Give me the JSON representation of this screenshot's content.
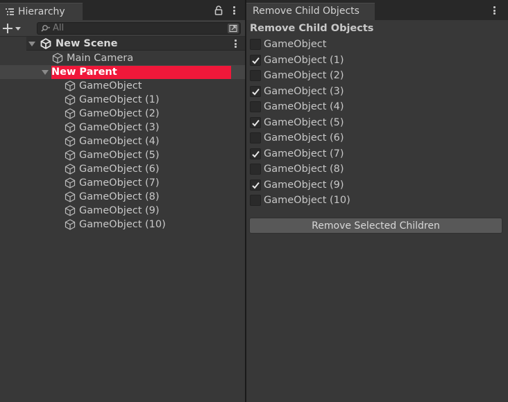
{
  "hierarchy": {
    "tab_label": "Hierarchy",
    "search_placeholder": "All",
    "scene_name": "New Scene",
    "items": [
      {
        "label": "Main Camera",
        "icon": "camera-object-icon"
      },
      {
        "label": "New Parent",
        "icon": "none",
        "selected": true
      },
      {
        "label": "GameObject",
        "icon": "cube-icon"
      },
      {
        "label": "GameObject (1)",
        "icon": "cube-icon"
      },
      {
        "label": "GameObject (2)",
        "icon": "cube-icon"
      },
      {
        "label": "GameObject (3)",
        "icon": "cube-icon"
      },
      {
        "label": "GameObject (4)",
        "icon": "cube-icon"
      },
      {
        "label": "GameObject (5)",
        "icon": "cube-icon"
      },
      {
        "label": "GameObject (6)",
        "icon": "cube-icon"
      },
      {
        "label": "GameObject (7)",
        "icon": "cube-icon"
      },
      {
        "label": "GameObject (8)",
        "icon": "cube-icon"
      },
      {
        "label": "GameObject (9)",
        "icon": "cube-icon"
      },
      {
        "label": "GameObject (10)",
        "icon": "cube-icon"
      }
    ]
  },
  "remove_panel": {
    "tab_label": "Remove Child Objects",
    "heading": "Remove Child Objects",
    "children": [
      {
        "label": "GameObject",
        "checked": false
      },
      {
        "label": "GameObject (1)",
        "checked": true
      },
      {
        "label": "GameObject (2)",
        "checked": false
      },
      {
        "label": "GameObject (3)",
        "checked": true
      },
      {
        "label": "GameObject (4)",
        "checked": false
      },
      {
        "label": "GameObject (5)",
        "checked": true
      },
      {
        "label": "GameObject (6)",
        "checked": false
      },
      {
        "label": "GameObject (7)",
        "checked": true
      },
      {
        "label": "GameObject (8)",
        "checked": false
      },
      {
        "label": "GameObject (9)",
        "checked": true
      },
      {
        "label": "GameObject (10)",
        "checked": false
      }
    ],
    "button_label": "Remove Selected Children"
  },
  "colors": {
    "selection_highlight": "#f0183a",
    "panel_background": "#383838",
    "tab_bar_background": "#282828"
  }
}
